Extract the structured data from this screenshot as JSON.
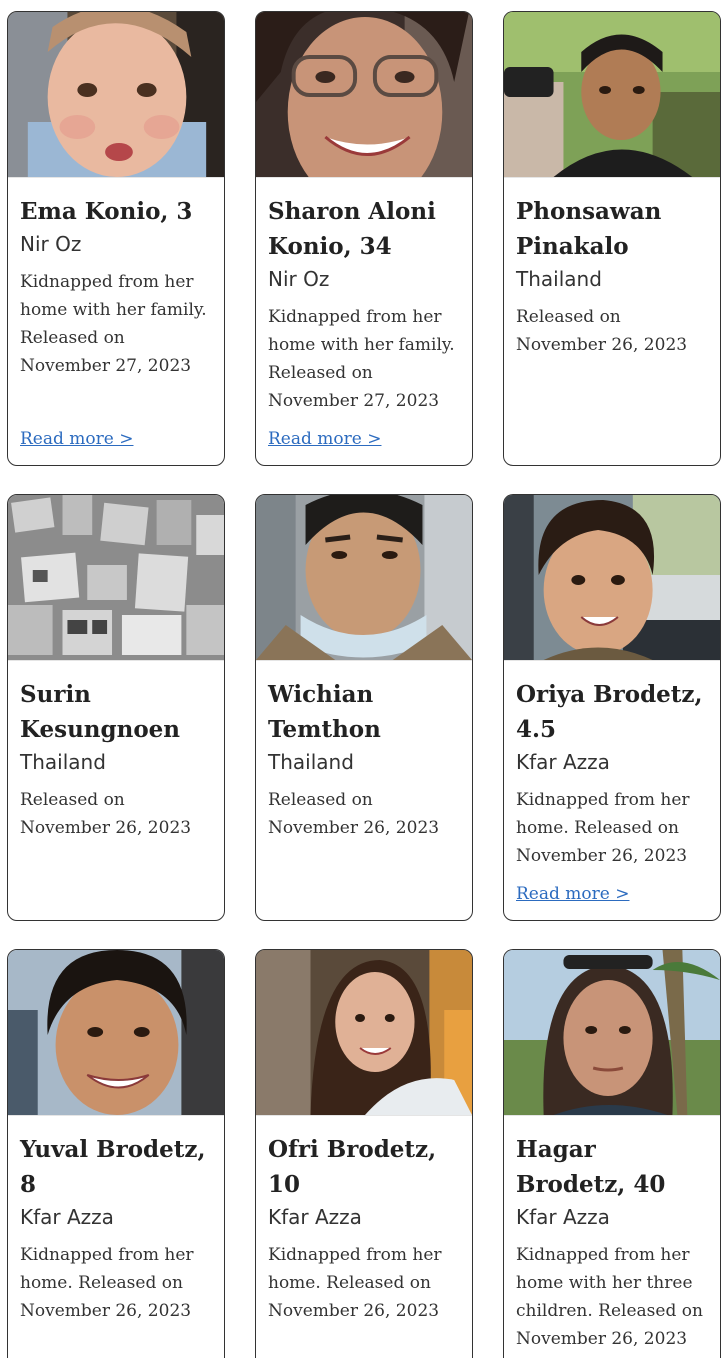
{
  "cards": [
    {
      "name": "Ema Konio, 3",
      "place": "Nir Oz",
      "description": "Kidnapped from her home with her family. Released on November 27, 2023",
      "read_more": "Read more >",
      "photo": "child-photo"
    },
    {
      "name": "Sharon Aloni Konio, 34",
      "place": "Nir Oz",
      "description": "Kidnapped from her home with her family. Released on November 27, 2023",
      "read_more": "Read more >",
      "photo": "woman-glasses-photo"
    },
    {
      "name": "Phonsawan Pinakalo",
      "place": "Thailand",
      "description": "Released on November 26, 2023",
      "photo": "man-photo"
    },
    {
      "name": "Surin Kesungnoen",
      "place": "Thailand",
      "description": "Released on November 26, 2023",
      "photo": "posters-photo"
    },
    {
      "name": "Wichian Temthon",
      "place": "Thailand",
      "description": "Released on November 26, 2023",
      "photo": "man-photo"
    },
    {
      "name": "Oriya Brodetz, 4.5",
      "place": "Kfar Azza",
      "description": "Kidnapped from her home. Released on November 26, 2023",
      "read_more": "Read more >",
      "photo": "child-photo"
    },
    {
      "name": "Yuval Brodetz, 8",
      "place": "Kfar Azza",
      "description": "Kidnapped from her home. Released on November 26, 2023",
      "photo": "boy-photo"
    },
    {
      "name": "Ofri Brodetz, 10",
      "place": "Kfar Azza",
      "description": "Kidnapped from her home. Released on November 26, 2023",
      "photo": "girl-photo"
    },
    {
      "name": "Hagar Brodetz, 40",
      "place": "Kfar Azza",
      "description": "Kidnapped from her home with her three children. Released on November 26, 2023",
      "photo": "woman-photo"
    }
  ]
}
